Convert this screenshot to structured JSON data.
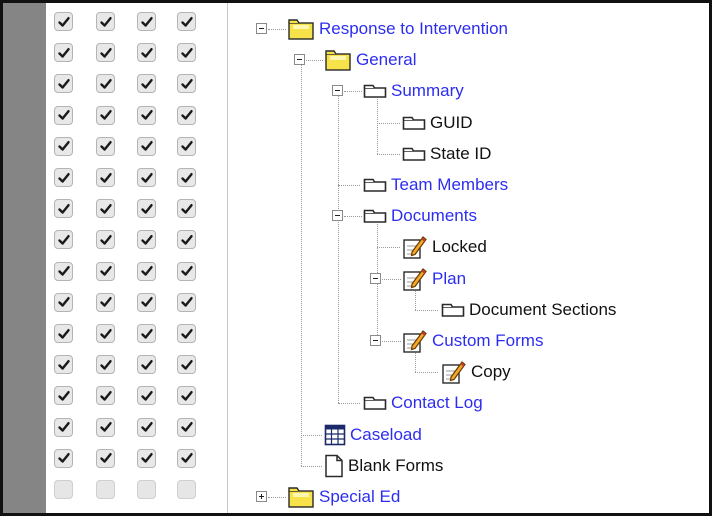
{
  "checkbox_rows": [
    {
      "states": [
        true,
        true,
        true,
        true
      ]
    },
    {
      "states": [
        true,
        true,
        true,
        true
      ]
    },
    {
      "states": [
        true,
        true,
        true,
        true
      ]
    },
    {
      "states": [
        true,
        true,
        true,
        true
      ]
    },
    {
      "states": [
        true,
        true,
        true,
        true
      ]
    },
    {
      "states": [
        true,
        true,
        true,
        true
      ]
    },
    {
      "states": [
        true,
        true,
        true,
        true
      ]
    },
    {
      "states": [
        true,
        true,
        true,
        true
      ]
    },
    {
      "states": [
        true,
        true,
        true,
        true
      ]
    },
    {
      "states": [
        true,
        true,
        true,
        true
      ]
    },
    {
      "states": [
        true,
        true,
        true,
        true
      ]
    },
    {
      "states": [
        true,
        true,
        true,
        true
      ]
    },
    {
      "states": [
        true,
        true,
        true,
        true
      ]
    },
    {
      "states": [
        true,
        true,
        true,
        true
      ]
    },
    {
      "states": [
        true,
        true,
        true,
        true
      ]
    },
    {
      "states": [
        false,
        false,
        false,
        false
      ]
    }
  ],
  "tree": [
    {
      "label": "Response to Intervention",
      "icon": "folder-icon",
      "link": true,
      "expander": "collapse"
    },
    {
      "label": "General",
      "icon": "folder-icon",
      "link": true,
      "expander": "collapse"
    },
    {
      "label": "Summary",
      "icon": "tab-icon",
      "link": true,
      "expander": "collapse"
    },
    {
      "label": "GUID",
      "icon": "tab-icon",
      "link": false
    },
    {
      "label": "State ID",
      "icon": "tab-icon",
      "link": false
    },
    {
      "label": "Team Members",
      "icon": "tab-icon",
      "link": true
    },
    {
      "label": "Documents",
      "icon": "tab-icon",
      "link": true,
      "expander": "collapse"
    },
    {
      "label": "Locked",
      "icon": "edit-icon",
      "link": false
    },
    {
      "label": "Plan",
      "icon": "edit-icon",
      "link": true,
      "expander": "collapse"
    },
    {
      "label": "Document Sections",
      "icon": "tab-icon",
      "link": false
    },
    {
      "label": "Custom Forms",
      "icon": "edit-icon",
      "link": true,
      "expander": "collapse"
    },
    {
      "label": "Copy",
      "icon": "edit-icon",
      "link": false
    },
    {
      "label": "Contact Log",
      "icon": "tab-icon",
      "link": true
    },
    {
      "label": "Caseload",
      "icon": "grid-icon",
      "link": true
    },
    {
      "label": "Blank Forms",
      "icon": "document-icon",
      "link": false
    },
    {
      "label": "Special Ed",
      "icon": "folder-icon",
      "link": true,
      "expander": "expand"
    }
  ],
  "colors": {
    "link": "#2d2df0",
    "sidebar": "#858585",
    "folder": "#f7e24a"
  }
}
